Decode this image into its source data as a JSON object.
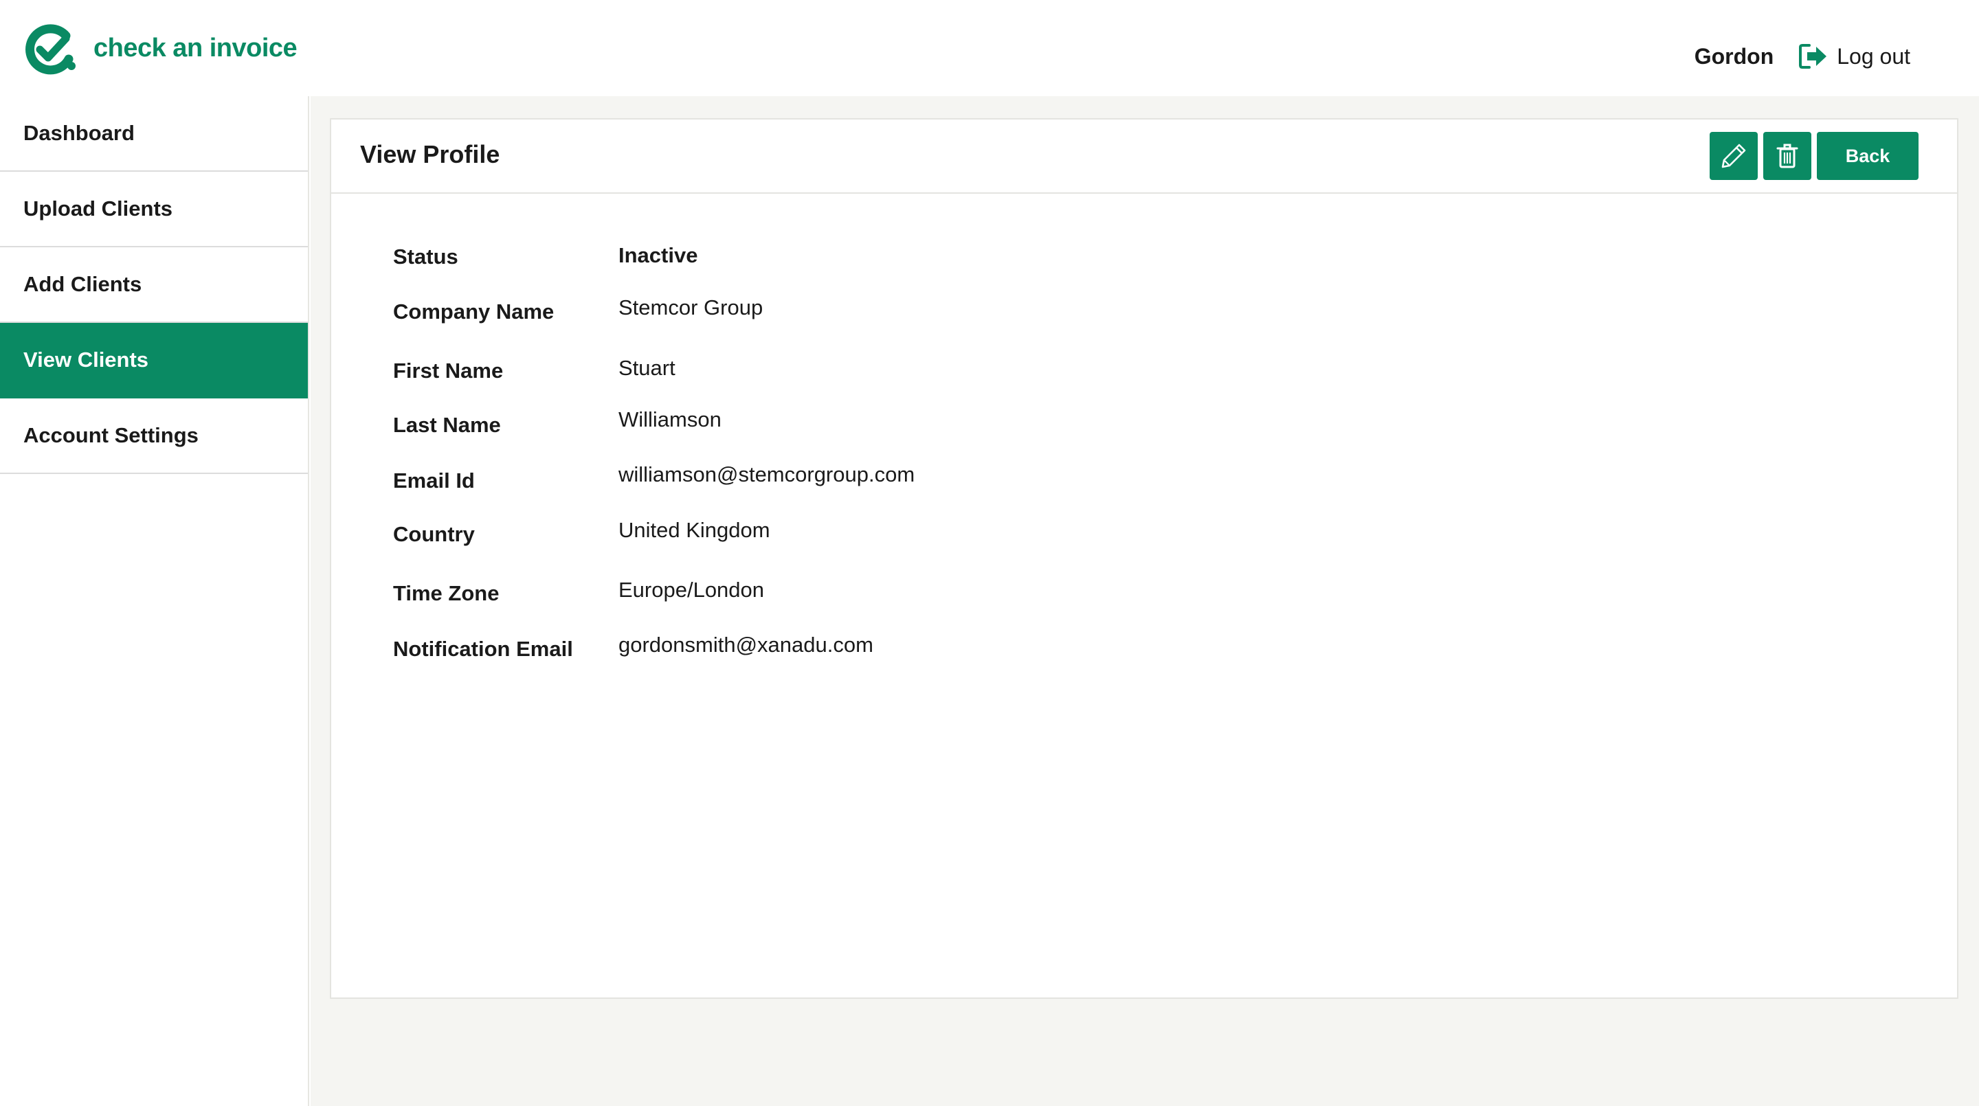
{
  "app": {
    "name": "check an invoice",
    "accent_color": "#0a8a63"
  },
  "header": {
    "username": "Gordon",
    "logout_label": "Log out",
    "logout_icon": "sign-out-icon"
  },
  "sidebar": {
    "items": [
      {
        "label": "Dashboard",
        "active": false
      },
      {
        "label": "Upload Clients",
        "active": false
      },
      {
        "label": "Add Clients",
        "active": false
      },
      {
        "label": "View Clients",
        "active": true
      },
      {
        "label": "Account Settings",
        "active": false
      }
    ]
  },
  "profile": {
    "title": "View Profile",
    "edit_icon": "pencil-icon",
    "delete_icon": "trash-icon",
    "back_label": "Back",
    "fields": [
      {
        "label": "Status",
        "value": "Inactive"
      },
      {
        "label": "Company Name",
        "value": "Stemcor Group"
      },
      {
        "label": "First Name",
        "value": "Stuart"
      },
      {
        "label": "Last Name",
        "value": "Williamson"
      },
      {
        "label": "Email Id",
        "value": "williamson@stemcorgroup.com"
      },
      {
        "label": "Country",
        "value": "United Kingdom"
      },
      {
        "label": "Time Zone",
        "value": "Europe/London"
      },
      {
        "label": "Notification Email",
        "value": "gordonsmith@xanadu.com"
      }
    ]
  }
}
